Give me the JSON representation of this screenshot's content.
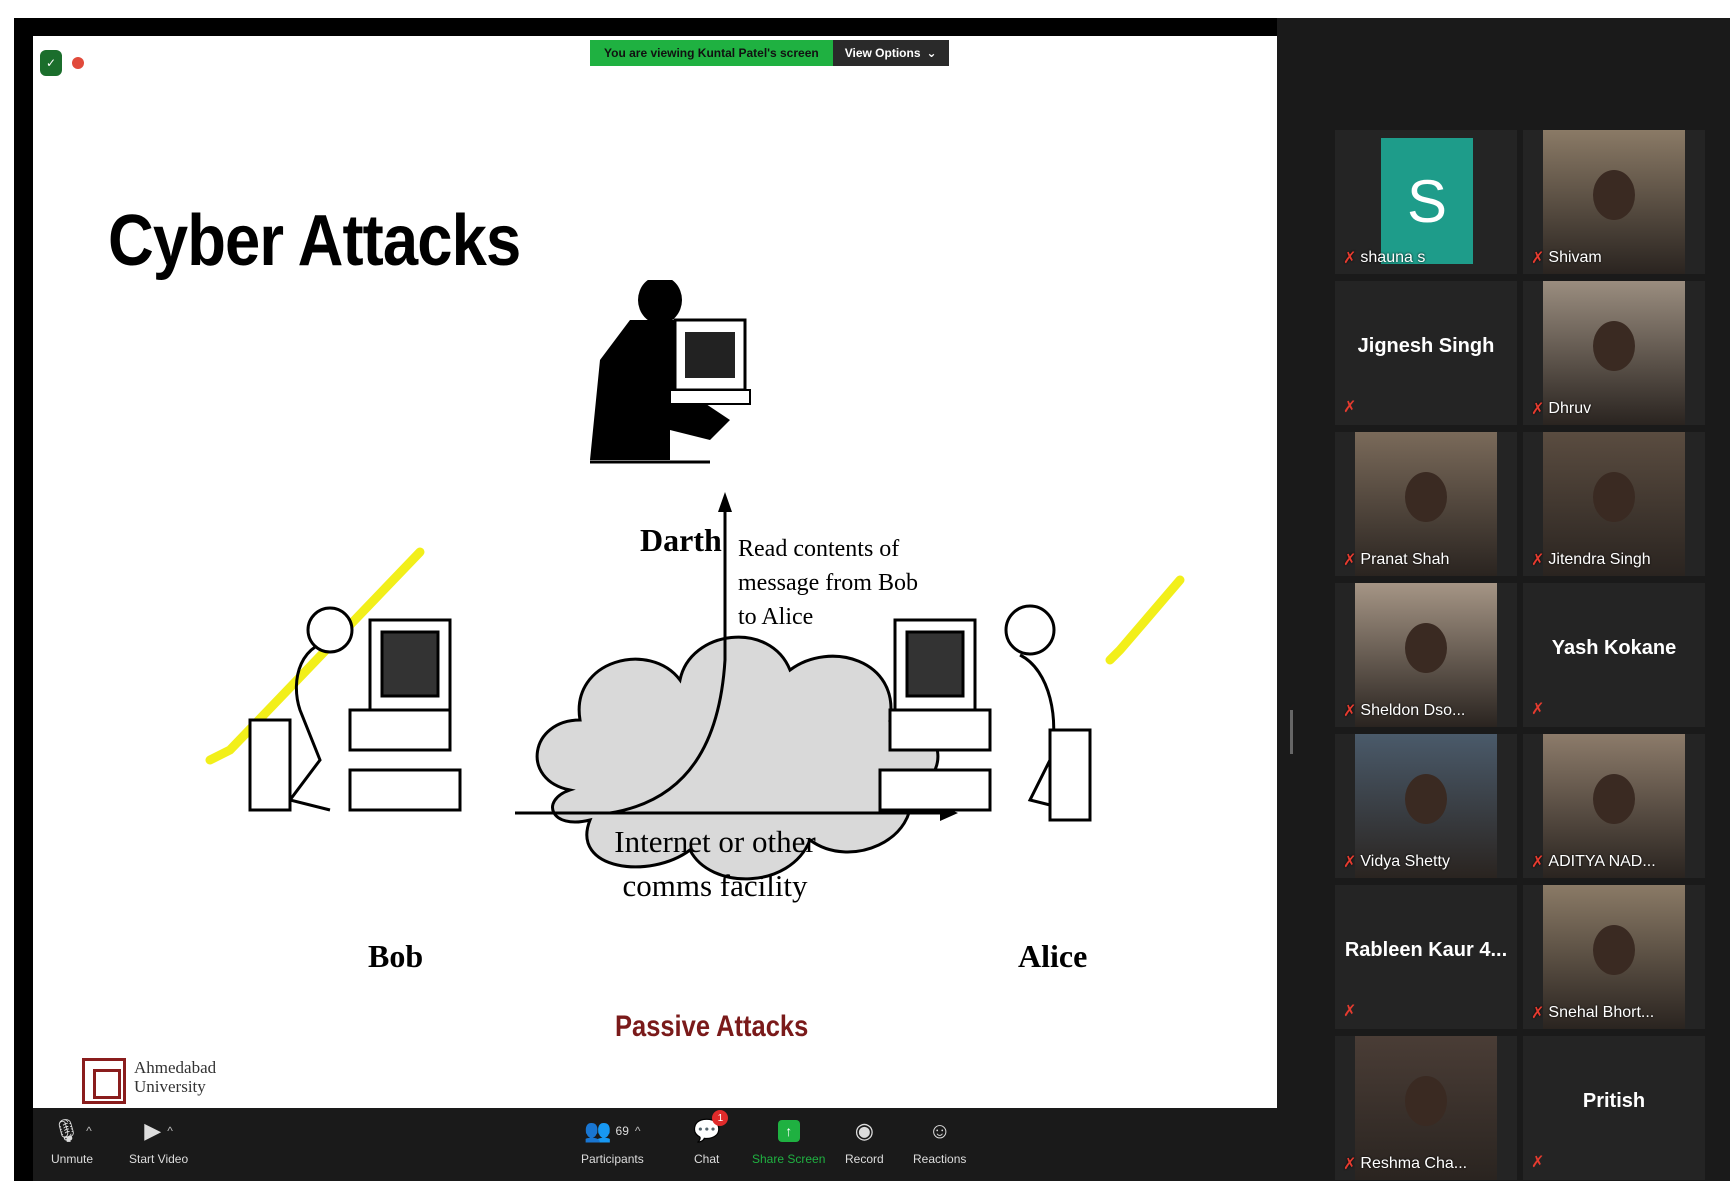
{
  "banner": {
    "viewing_text": "You are viewing Kuntal Patel's screen",
    "view_options": "View Options"
  },
  "slide": {
    "title": "Cyber Attacks",
    "darth": "Darth",
    "read_note": "Read contents of message from Bob to Alice",
    "bob": "Bob",
    "alice": "Alice",
    "cloud_text": "Internet or other comms facility",
    "caption": "Passive Attacks",
    "logo_line1": "Ahmedabad",
    "logo_line2": "University"
  },
  "toolbar": {
    "unmute": "Unmute",
    "start_video": "Start Video",
    "participants": "Participants",
    "participants_count": "69",
    "chat": "Chat",
    "chat_badge": "1",
    "share_screen": "Share Screen",
    "record": "Record",
    "reactions": "Reactions"
  },
  "participants": [
    {
      "name": "shauna s",
      "type": "avatar",
      "initial": "S",
      "avatar_color": "#1e9c8a"
    },
    {
      "name": "Shivam",
      "type": "video"
    },
    {
      "name": "Jignesh Singh",
      "type": "name"
    },
    {
      "name": "Dhruv",
      "type": "video"
    },
    {
      "name": "Pranat Shah",
      "type": "video"
    },
    {
      "name": "Jitendra Singh",
      "type": "video"
    },
    {
      "name": "Sheldon Dso...",
      "type": "video"
    },
    {
      "name": "Yash Kokane",
      "type": "name"
    },
    {
      "name": "Vidya Shetty",
      "type": "video"
    },
    {
      "name": "ADITYA NAD...",
      "type": "video"
    },
    {
      "name": "Rableen Kaur 4...",
      "type": "name"
    },
    {
      "name": "Snehal Bhort...",
      "type": "video"
    },
    {
      "name": "Reshma Cha...",
      "type": "video"
    },
    {
      "name": "Pritish",
      "type": "name"
    }
  ],
  "colors": {
    "accent_green": "#1fb141",
    "mute_red": "#e53b2f",
    "caption_red": "#7a1a1a",
    "highlight_yellow": "#f2ef1a"
  }
}
